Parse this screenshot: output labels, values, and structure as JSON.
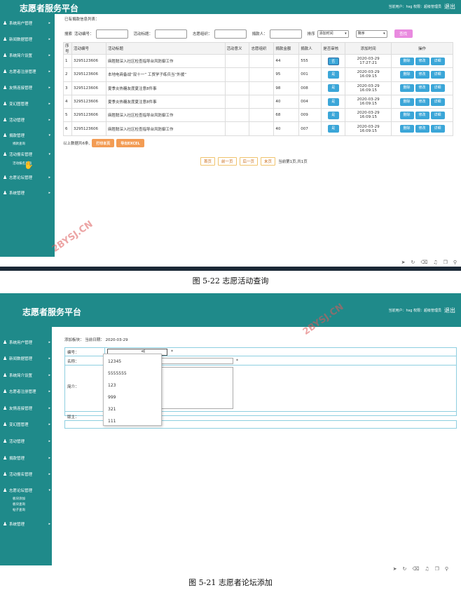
{
  "app": {
    "title": "志愿者服务平台",
    "user_info": "当前用户：hsg  权限：超级管理员",
    "logout": "退出"
  },
  "sidebar1": {
    "items": [
      {
        "label": "系统用户管理"
      },
      {
        "label": "新闻数据管理"
      },
      {
        "label": "系统简介设置"
      },
      {
        "label": "志愿者注册管理"
      },
      {
        "label": "友情连接管理"
      },
      {
        "label": "变幻图管理"
      },
      {
        "label": "活动管理"
      },
      {
        "label": "捐款管理"
      },
      {
        "label": "活动报名管理"
      },
      {
        "label": "志愿论坛管理"
      },
      {
        "label": "系统管理"
      }
    ],
    "subitems": [
      "捐款查询",
      "活动报名查询"
    ]
  },
  "screen1": {
    "breadcrumb": "已有捐款信息列表：",
    "search": {
      "search_label": "搜索",
      "field1": "活动编号：",
      "field2": "活动标题：",
      "field3": "志愿组织：",
      "field4": "捐款人：",
      "sort_label": "排序",
      "sort_field": "添加时间",
      "sort_order": "降序",
      "find_button": "查找"
    },
    "columns": [
      "序号",
      "活动编号",
      "活动标题",
      "活动意义",
      "志愿组织",
      "捐款金额",
      "捐款人",
      "是否审核",
      "添加时间",
      "操作"
    ],
    "rows": [
      {
        "idx": "1",
        "code": "3295123606",
        "title": "麻胜聪深入社区检查指导台风防御工作",
        "amount": "44",
        "donor": "555",
        "audit": "否",
        "time1": "2020-03-29",
        "time2": "17:27:21"
      },
      {
        "idx": "2",
        "code": "3295123606",
        "title": "本地电商备战“双十一” 工贸学子练兵当“外援”",
        "amount": "95",
        "donor": "001",
        "audit": "是",
        "time1": "2020-03-29",
        "time2": "16:09:15"
      },
      {
        "idx": "3",
        "code": "3295123606",
        "title": "夏季炎热糖友度夏注意8件事",
        "amount": "98",
        "donor": "008",
        "audit": "是",
        "time1": "2020-03-29",
        "time2": "16:09:15"
      },
      {
        "idx": "4",
        "code": "3295123606",
        "title": "夏季炎热糖友度夏注意8件事",
        "amount": "40",
        "donor": "004",
        "audit": "是",
        "time1": "2020-03-29",
        "time2": "16:09:15"
      },
      {
        "idx": "5",
        "code": "3295123606",
        "title": "麻胜聪深入社区检查指导台风防御工作",
        "amount": "68",
        "donor": "009",
        "audit": "是",
        "time1": "2020-03-29",
        "time2": "16:09:15"
      },
      {
        "idx": "6",
        "code": "3295123606",
        "title": "麻胜聪深入社区检查指导台风防御工作",
        "amount": "40",
        "donor": "007",
        "audit": "是",
        "time1": "2020-03-29",
        "time2": "16:09:15"
      }
    ],
    "actions": {
      "delete": "删除",
      "edit": "修改",
      "detail": "详细"
    },
    "summary": "以上数据共6条,",
    "print_button": "打印本页",
    "export_button": "导出EXCEL",
    "pager": {
      "first": "首页",
      "prev": "前一页",
      "next": "后一页",
      "last": "末页",
      "status": "当前第1页,共1页"
    }
  },
  "caption1": "图 5-22 志愿活动查询",
  "sidebar2": {
    "items": [
      {
        "label": "系统用户管理"
      },
      {
        "label": "新闻数据管理"
      },
      {
        "label": "系统简介设置"
      },
      {
        "label": "志愿者注册管理"
      },
      {
        "label": "友情连接管理"
      },
      {
        "label": "变幻图管理"
      },
      {
        "label": "活动管理"
      },
      {
        "label": "捐款管理"
      },
      {
        "label": "活动报名管理"
      },
      {
        "label": "志愿论坛管理"
      },
      {
        "label": "系统管理"
      }
    ],
    "subitems": [
      "板块添加",
      "板块查询",
      "帖子查询"
    ]
  },
  "screen2": {
    "heading": "添加板块：  当前日期：  2020-03-29",
    "fields": {
      "code": "编号：",
      "name": "名称：",
      "intro": "简介：",
      "owner": "版主："
    },
    "required_mark": "*",
    "autocomplete": [
      "12345",
      "5555555",
      "123",
      "999",
      "321",
      "111"
    ]
  },
  "caption2": "图 5-21 志愿者论坛添加",
  "watermark": "2BYSJ.CN"
}
